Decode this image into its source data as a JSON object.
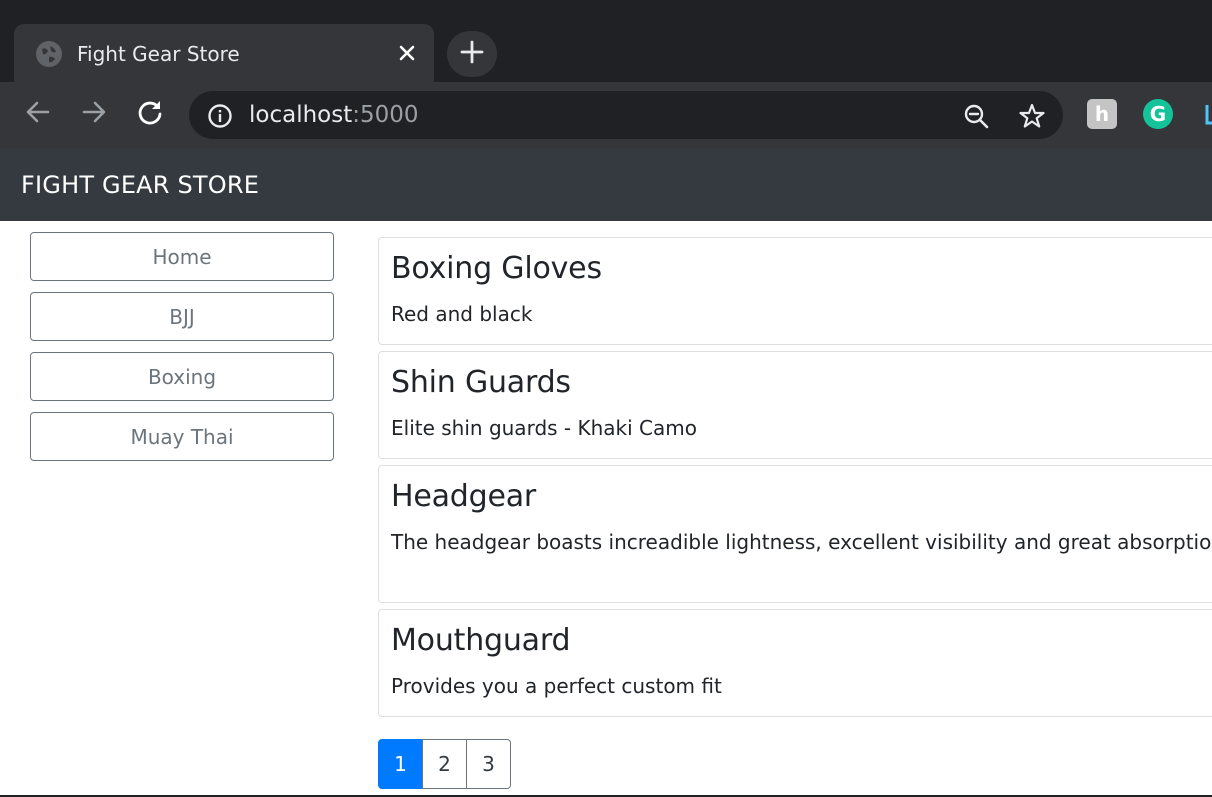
{
  "browser": {
    "tab_title": "Fight Gear Store",
    "url_host": "localhost",
    "url_port": ":5000",
    "icons": {
      "favicon": "globe-icon",
      "close": "close-icon",
      "new_tab": "plus-icon",
      "back": "back-arrow-icon",
      "forward": "forward-arrow-icon",
      "reload": "reload-icon",
      "site_info": "info-icon",
      "zoom": "zoom-out-icon",
      "bookmark": "star-icon"
    },
    "extensions": [
      {
        "name": "honey-extension-icon",
        "glyph": "h",
        "color": "#c4c4c4"
      },
      {
        "name": "grammarly-extension-icon",
        "glyph": "G",
        "color": "#15c39a"
      }
    ]
  },
  "navbar": {
    "brand": "FIGHT GEAR STORE"
  },
  "sidebar": {
    "items": [
      {
        "label": "Home"
      },
      {
        "label": "BJJ"
      },
      {
        "label": "Boxing"
      },
      {
        "label": "Muay Thai"
      }
    ]
  },
  "products": [
    {
      "title": "Boxing Gloves",
      "description": "Red and black"
    },
    {
      "title": "Shin Guards",
      "description": "Elite shin guards - Khaki Camo"
    },
    {
      "title": "Headgear",
      "description": "The headgear boasts increadible lightness, excellent visibility and great absorption of blo"
    },
    {
      "title": "Mouthguard",
      "description": "Provides you a perfect custom fit"
    }
  ],
  "pagination": {
    "pages": [
      "1",
      "2",
      "3"
    ],
    "active": "1"
  },
  "colors": {
    "navbar_bg": "#343a40",
    "accent": "#007bff",
    "sidebar_button": "#6c757d"
  }
}
